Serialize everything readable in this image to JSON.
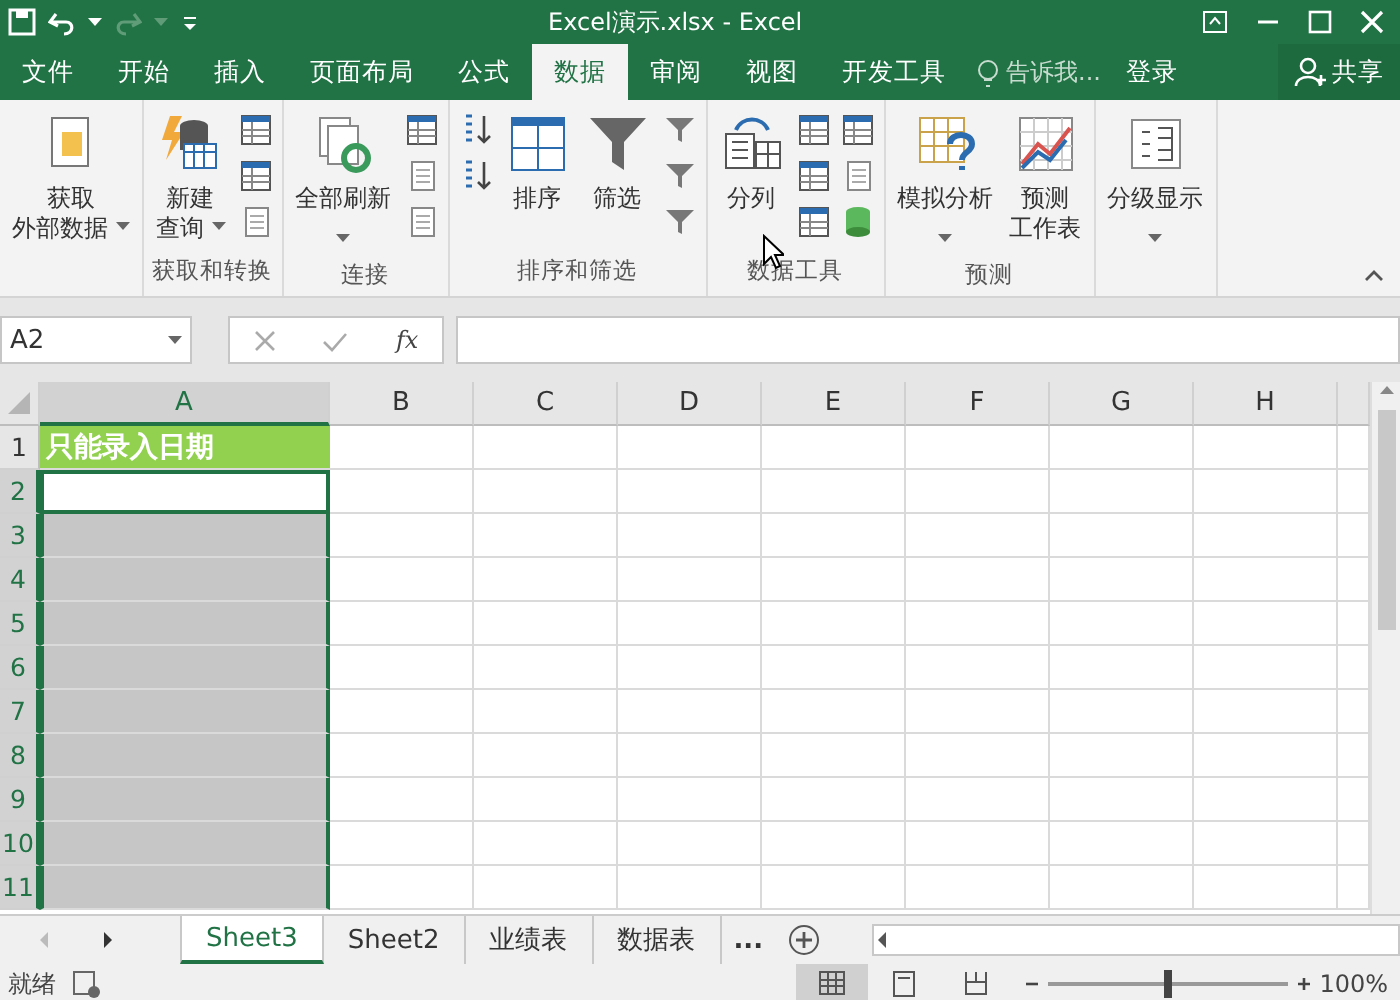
{
  "window": {
    "title": "Excel演示.xlsx - Excel"
  },
  "tabs": [
    {
      "label": "文件",
      "selected": false
    },
    {
      "label": "开始",
      "selected": false
    },
    {
      "label": "插入",
      "selected": false
    },
    {
      "label": "页面布局",
      "selected": false
    },
    {
      "label": "公式",
      "selected": false
    },
    {
      "label": "数据",
      "selected": true
    },
    {
      "label": "审阅",
      "selected": false
    },
    {
      "label": "视图",
      "selected": false
    },
    {
      "label": "开发工具",
      "selected": false
    }
  ],
  "tell_me": {
    "placeholder": "告诉我..."
  },
  "sign_in": "登录",
  "share": "共享",
  "ribbon": [
    {
      "buttons": [
        {
          "lines": [
            "获取",
            "外部数据"
          ],
          "dropdown": true
        }
      ]
    },
    {
      "label": "获取和转换",
      "buttons": [
        {
          "lines": [
            "新建",
            "查询"
          ],
          "dropdown": true
        }
      ]
    },
    {
      "label": "连接",
      "buttons": [
        {
          "lines": [
            "全部刷新"
          ],
          "dropdown": true
        }
      ]
    },
    {
      "label": "排序和筛选",
      "buttons": [
        {
          "lines": [
            "排序"
          ],
          "dropdown": false
        },
        {
          "lines": [
            "筛选"
          ],
          "dropdown": false
        }
      ]
    },
    {
      "label": "数据工具",
      "buttons": [
        {
          "lines": [
            "分列"
          ],
          "dropdown": false
        }
      ]
    },
    {
      "label": "预测",
      "buttons": [
        {
          "lines": [
            "模拟分析"
          ],
          "dropdown": true
        },
        {
          "lines": [
            "预测",
            "工作表"
          ],
          "dropdown": false
        }
      ]
    },
    {
      "buttons": [
        {
          "lines": [
            "分级显示"
          ],
          "dropdown": true
        }
      ]
    }
  ],
  "formula_bar": {
    "name_box": "A2",
    "function_button": "fx"
  },
  "grid": {
    "columns": [
      {
        "label": "A",
        "selected": true
      },
      {
        "label": "B",
        "selected": false
      },
      {
        "label": "C",
        "selected": false
      },
      {
        "label": "D",
        "selected": false
      },
      {
        "label": "E",
        "selected": false
      },
      {
        "label": "F",
        "selected": false
      },
      {
        "label": "G",
        "selected": false
      },
      {
        "label": "H",
        "selected": false
      }
    ],
    "rows": [
      {
        "label": "1",
        "selected": false,
        "active": false,
        "value": "只能录入日期"
      },
      {
        "label": "2",
        "selected": true,
        "active": true
      },
      {
        "label": "3",
        "selected": true,
        "active": false
      },
      {
        "label": "4",
        "selected": true,
        "active": false
      },
      {
        "label": "5",
        "selected": true,
        "active": false
      },
      {
        "label": "6",
        "selected": true,
        "active": false
      },
      {
        "label": "7",
        "selected": true,
        "active": false
      },
      {
        "label": "8",
        "selected": true,
        "active": false
      },
      {
        "label": "9",
        "selected": true,
        "active": false
      },
      {
        "label": "10",
        "selected": true,
        "active": false
      },
      {
        "label": "11",
        "selected": true,
        "active": false
      }
    ]
  },
  "sheets": [
    {
      "label": "Sheet3",
      "selected": true
    },
    {
      "label": "Sheet2",
      "selected": false
    },
    {
      "label": "业绩表",
      "selected": false
    },
    {
      "label": "数据表",
      "selected": false
    }
  ],
  "more_sheets": "...",
  "status_bar": {
    "text": "就绪",
    "views": [
      {
        "selected": true
      },
      {
        "selected": false
      },
      {
        "selected": false
      }
    ],
    "zoom": {
      "level": 0.5,
      "reading": "100%"
    }
  }
}
